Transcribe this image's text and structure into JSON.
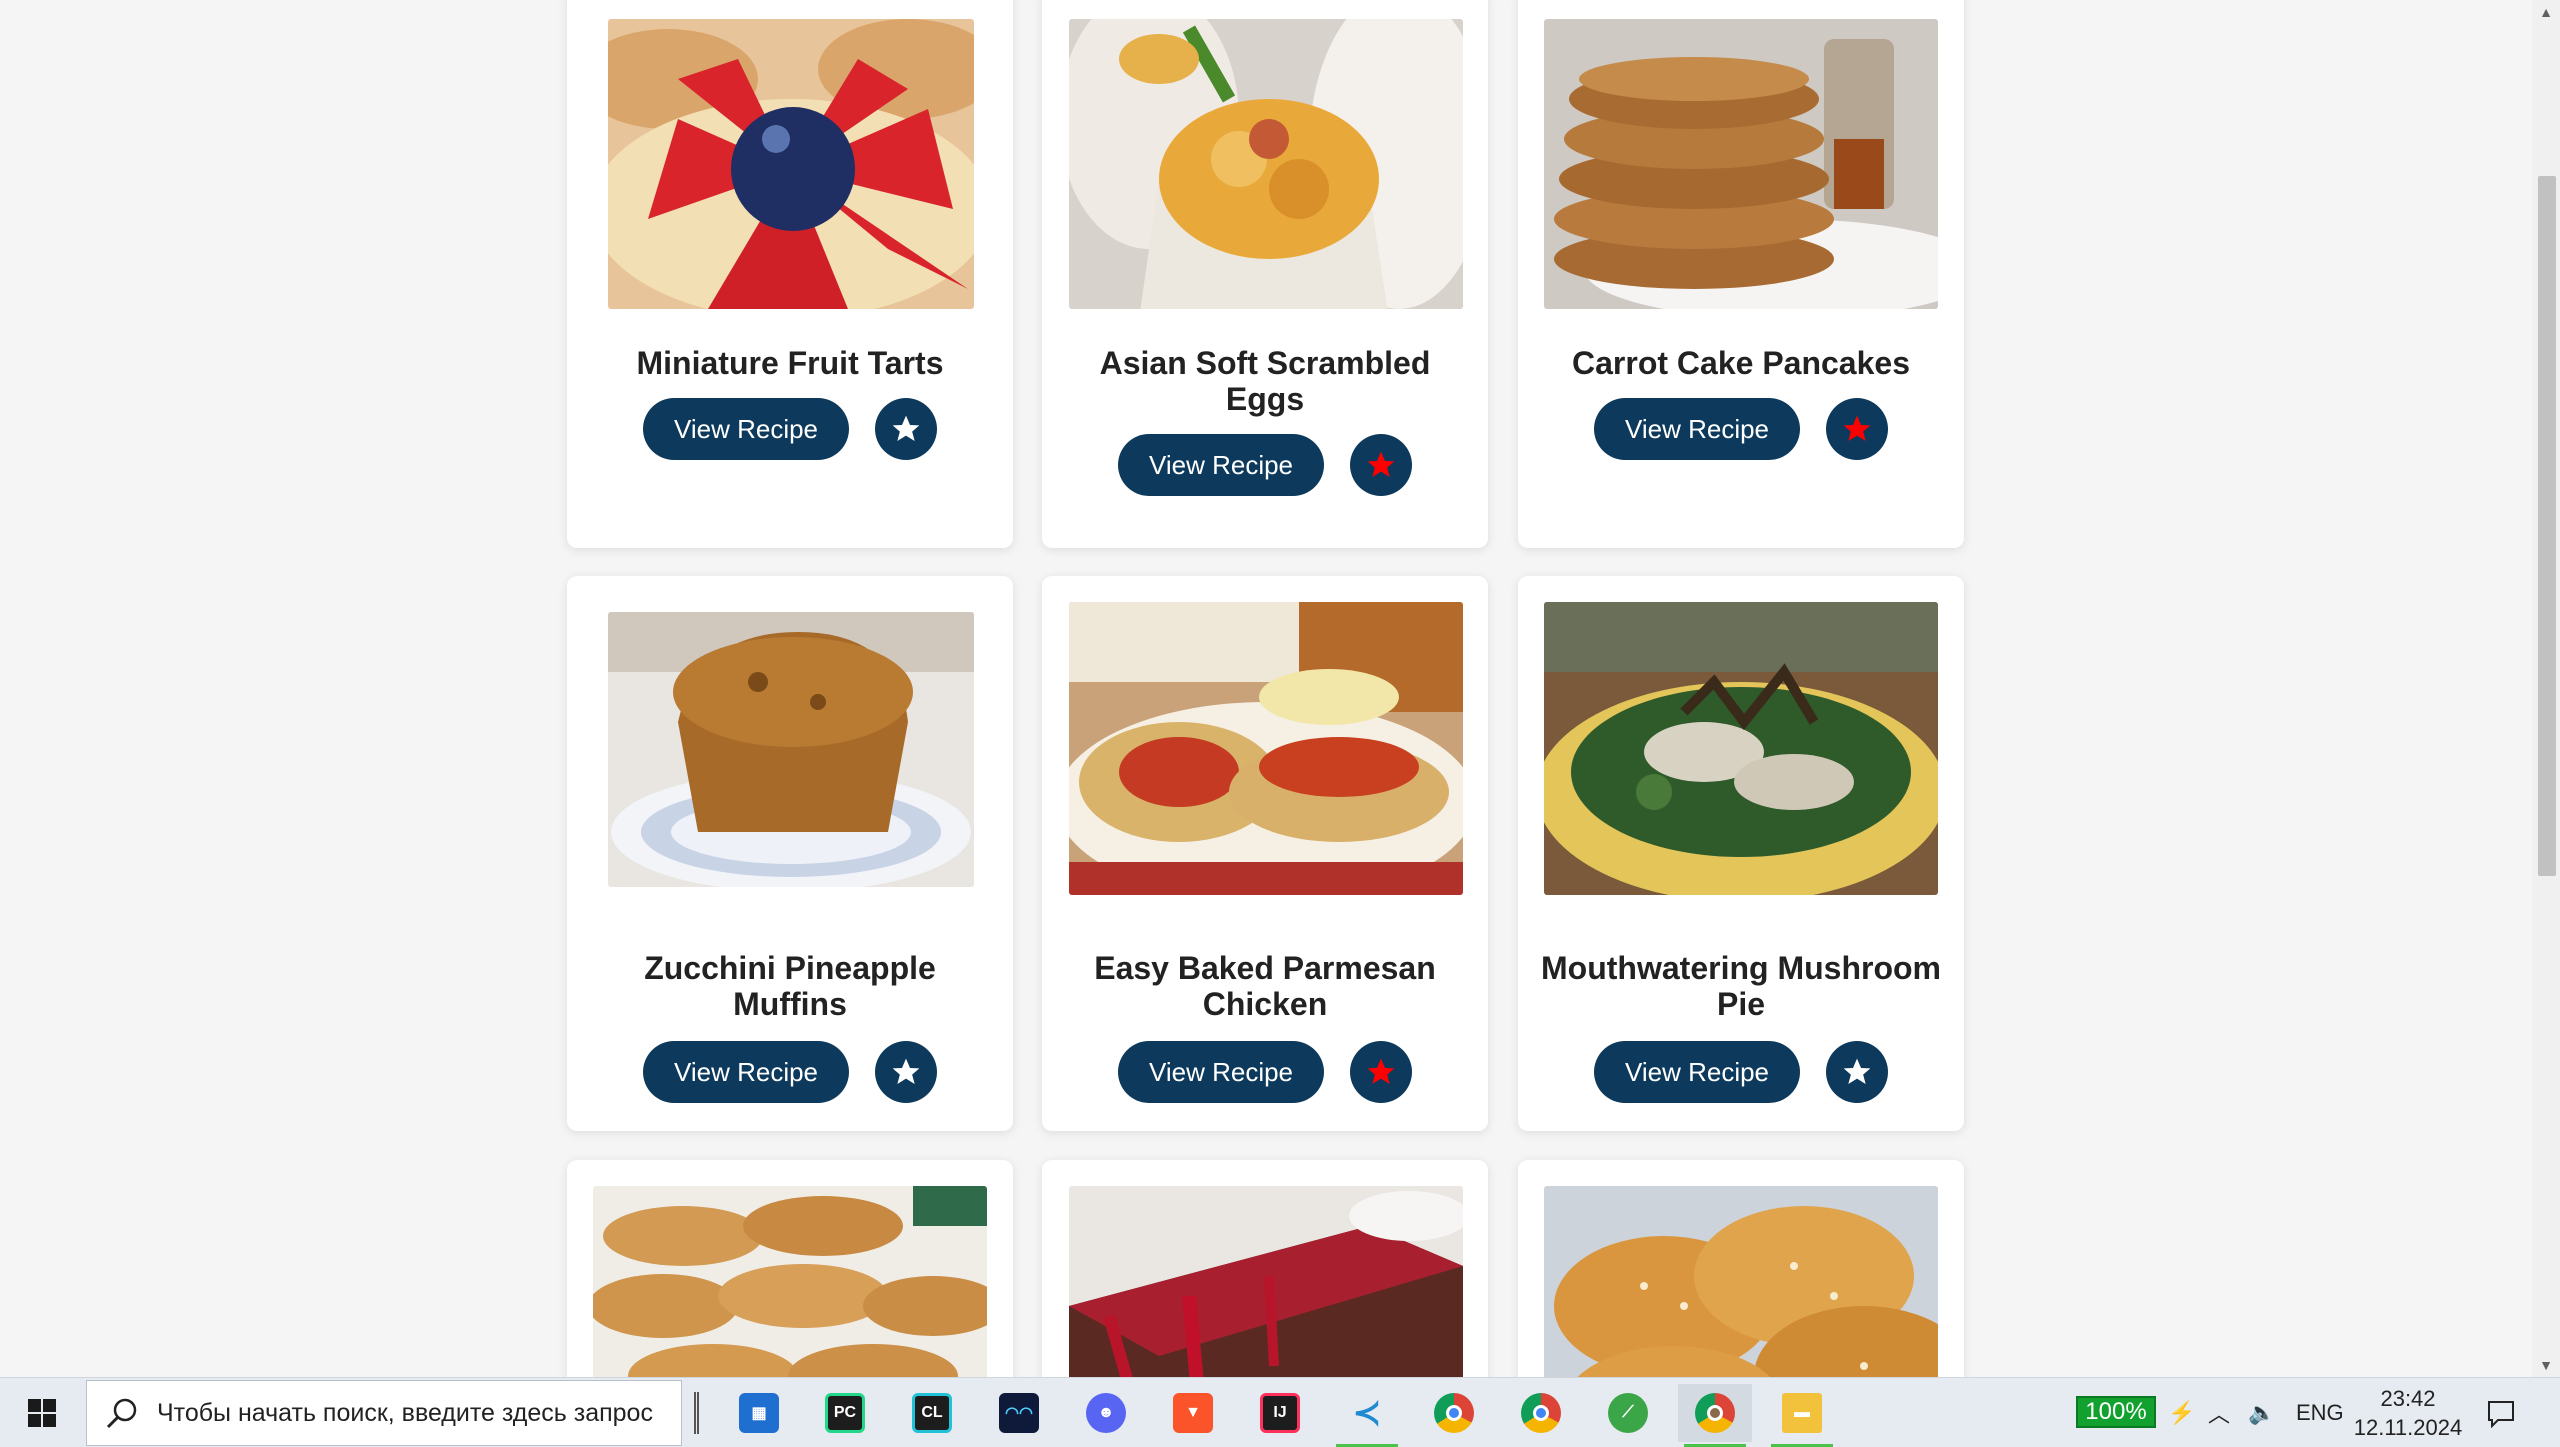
{
  "colors": {
    "button_bg": "#0d3a5c",
    "button_text": "#ffffff",
    "favorite_active": "#ff0000",
    "favorite_inactive": "#ffffff",
    "page_bg": "#f5f5f5"
  },
  "recipes": [
    {
      "title": "Miniature Fruit Tarts",
      "button": "View Recipe",
      "favorite": false,
      "image": "fruit-tarts-photo"
    },
    {
      "title": "Asian Soft Scrambled Eggs",
      "button": "View Recipe",
      "favorite": true,
      "image": "scrambled-eggs-photo"
    },
    {
      "title": "Carrot Cake Pancakes",
      "button": "View Recipe",
      "favorite": true,
      "image": "pancakes-photo"
    },
    {
      "title": "Zucchini Pineapple Muffins",
      "button": "View Recipe",
      "favorite": false,
      "image": "muffin-photo"
    },
    {
      "title": "Easy Baked Parmesan Chicken",
      "button": "View Recipe",
      "favorite": true,
      "image": "parmesan-chicken-photo"
    },
    {
      "title": "Mouthwatering Mushroom Pie",
      "button": "View Recipe",
      "favorite": false,
      "image": "mushroom-pie-photo"
    },
    {
      "title": "",
      "image": "madeleines-photo"
    },
    {
      "title": "",
      "image": "cheesecake-photo"
    },
    {
      "title": "",
      "image": "challah-photo"
    }
  ],
  "taskbar": {
    "search_placeholder": "Чтобы начать поиск, введите здесь запрос",
    "apps": [
      "store-icon",
      "pycharm-icon",
      "clion-icon",
      "app-icon",
      "discord-icon",
      "brave-icon",
      "intellij-icon",
      "vscode-icon",
      "chrome-icon",
      "chrome-icon",
      "app-icon",
      "chrome-icon",
      "file-explorer-icon"
    ],
    "battery": "100%",
    "language": "ENG",
    "time": "23:42",
    "date": "12.11.2024"
  }
}
